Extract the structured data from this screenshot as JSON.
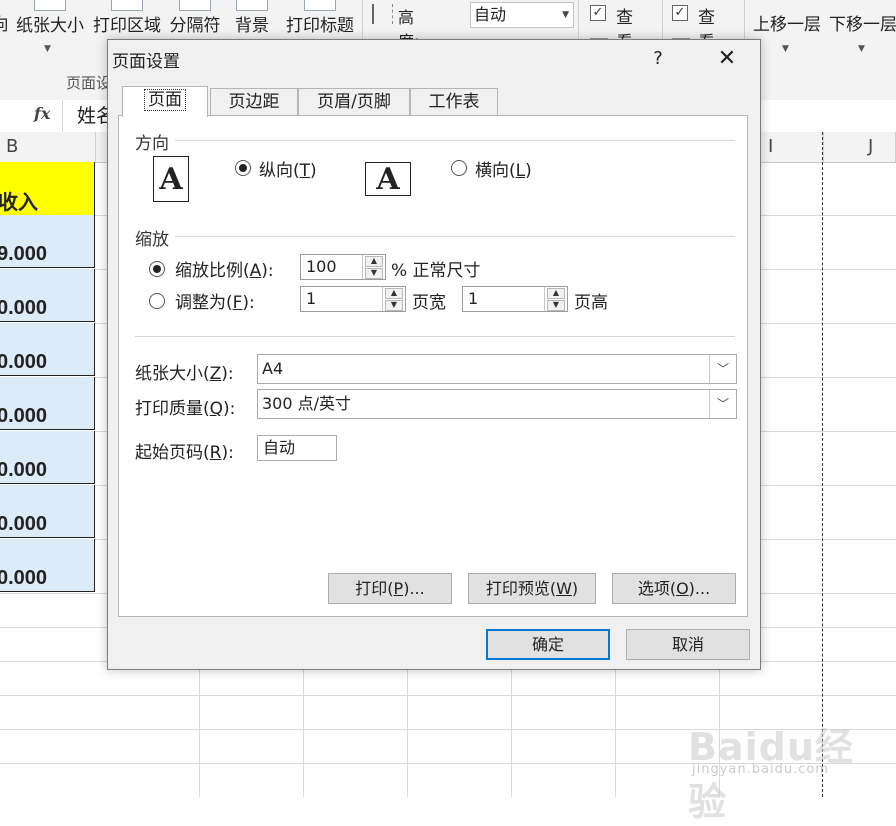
{
  "ribbon": {
    "buttons": [
      {
        "label": "向"
      },
      {
        "label": "纸张大小"
      },
      {
        "label": "打印区域"
      },
      {
        "label": "分隔符"
      },
      {
        "label": "背景"
      },
      {
        "label": "打印标题"
      },
      {
        "label": "上移一层"
      },
      {
        "label": "下移一层"
      }
    ],
    "group_label": "页面设",
    "height_label": "高度:",
    "height_value": "自动",
    "gridlines_view": "查看",
    "headings_view": "查看"
  },
  "formula_bar": {
    "fx": "fx",
    "content": "姓名"
  },
  "columns": [
    "B",
    "I",
    "J"
  ],
  "sheet": {
    "header": "收入",
    "values": [
      "9.000",
      "0.000",
      "0.000",
      "0.000",
      "0.000",
      "0.000",
      "0.000"
    ]
  },
  "dialog": {
    "title": "页面设置",
    "help": "?",
    "close": "✕",
    "tabs": [
      "页面",
      "页边距",
      "页眉/页脚",
      "工作表"
    ],
    "active_tab": "页面",
    "orientation": {
      "title": "方向",
      "portrait": {
        "text": "纵向(",
        "key": "T",
        "end": ")",
        "checked": true
      },
      "landscape": {
        "text": "横向(",
        "key": "L",
        "end": ")",
        "checked": false
      },
      "icon_letter": "A"
    },
    "scaling": {
      "title": "缩放",
      "adjust_to": {
        "text": "缩放比例(",
        "key": "A",
        "end": "):",
        "value": "100",
        "suffix": "% 正常尺寸",
        "checked": true
      },
      "fit_to": {
        "text": "调整为(",
        "key": "F",
        "end": "):",
        "checked": false,
        "wide_value": "1",
        "wide_label": "页宽",
        "tall_value": "1",
        "tall_label": "页高"
      }
    },
    "paper_size": {
      "text": "纸张大小(",
      "key": "Z",
      "end": "):",
      "value": "A4"
    },
    "print_quality": {
      "text": "打印质量(",
      "key": "Q",
      "end": "):",
      "value": "300 点/英寸"
    },
    "first_page": {
      "text": "起始页码(",
      "key": "R",
      "end": "):",
      "value": "自动"
    },
    "panel_buttons": {
      "print": {
        "text": "打印(",
        "key": "P",
        "end": ")..."
      },
      "preview": {
        "text": "打印预览(",
        "key": "W",
        "end": ")"
      },
      "options": {
        "text": "选项(",
        "key": "O",
        "end": ")..."
      }
    },
    "ok": "确定",
    "cancel": "取消"
  },
  "watermark": {
    "text": "Baidu经验",
    "sub": "jingyan.baidu.com"
  }
}
